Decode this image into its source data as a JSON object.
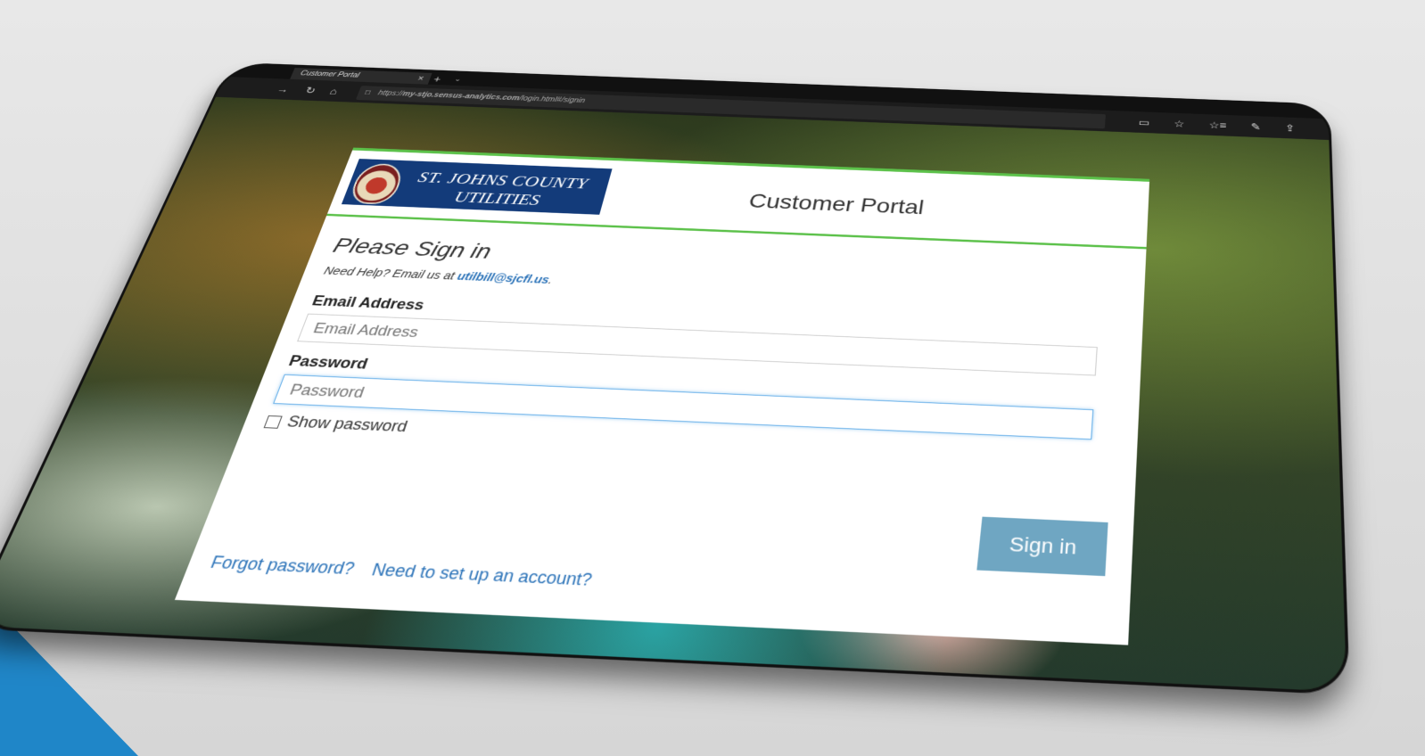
{
  "browser": {
    "tab_title": "Customer Portal",
    "tab_close": "×",
    "tab_new": "+",
    "tab_dropdown": "⌄",
    "url_prefix": "https://",
    "url_host": "my-stjo.sensus-analytics.com",
    "url_path": "/login.html#/signin",
    "nav_back": "→",
    "nav_refresh": "↻",
    "nav_home": "⌂",
    "lock_glyph": "🔒",
    "reading_view": "▭",
    "favorite": "☆",
    "favorites_hub": "☆≡",
    "notes": "✎",
    "share": "⇪"
  },
  "logo": {
    "line1": "ST. JOHNS COUNTY",
    "line2": "UTILITIES"
  },
  "header": {
    "title": "Customer Portal"
  },
  "form": {
    "heading": "Please Sign in",
    "help_prefix": "Need Help? Email us at ",
    "help_email": "utilbill@sjcfl.us",
    "help_suffix": ".",
    "email_label": "Email Address",
    "email_placeholder": "Email Address",
    "password_label": "Password",
    "password_placeholder": "Password",
    "show_password_label": "Show password",
    "signin_label": "Sign in",
    "forgot_label": "Forgot password?",
    "setup_label": "Need to set up an account?"
  },
  "colors": {
    "accent_green": "#5cc14a",
    "logo_navy": "#133b7a",
    "link_blue": "#2a72b8",
    "button_blue": "#6fa6c2",
    "corner_blue": "#1f86c8"
  }
}
